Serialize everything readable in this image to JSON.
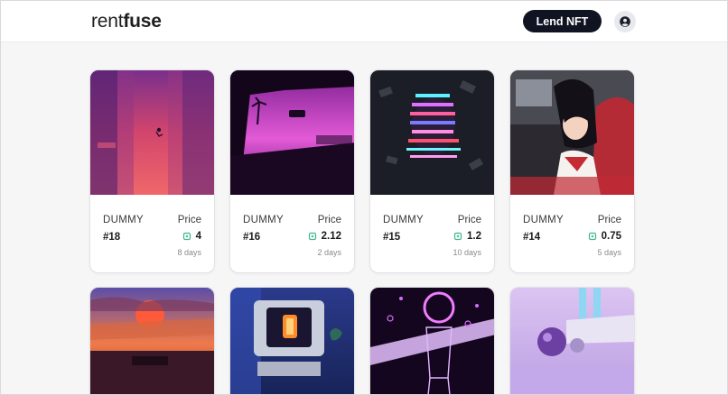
{
  "header": {
    "logo_light": "rent",
    "logo_bold": "fuse",
    "lend_button": "Lend NFT",
    "profile_icon": "user-circle-icon"
  },
  "colors": {
    "accent_dark": "#101322",
    "token_icon": "#3fb68b"
  },
  "cards": [
    {
      "collection": "DUMMY",
      "token": "#18",
      "price_label": "Price",
      "price": "4",
      "duration": "8 days",
      "art": "pink-city-skyfall"
    },
    {
      "collection": "DUMMY",
      "token": "#16",
      "price_label": "Price",
      "price": "2.12",
      "duration": "2 days",
      "art": "purple-sunset-car-window"
    },
    {
      "collection": "DUMMY",
      "token": "#15",
      "price_label": "Price",
      "price": "1.2",
      "duration": "10 days",
      "art": "neon-glitch-figure"
    },
    {
      "collection": "DUMMY",
      "token": "#14",
      "price_label": "Price",
      "price": "0.75",
      "duration": "5 days",
      "art": "anime-girl-car"
    }
  ],
  "cards_row2": [
    {
      "art": "orange-sunset-sea"
    },
    {
      "art": "retro-computer-monitor"
    },
    {
      "art": "neon-circle-astronaut"
    },
    {
      "art": "lilac-chrome-spheres"
    }
  ]
}
